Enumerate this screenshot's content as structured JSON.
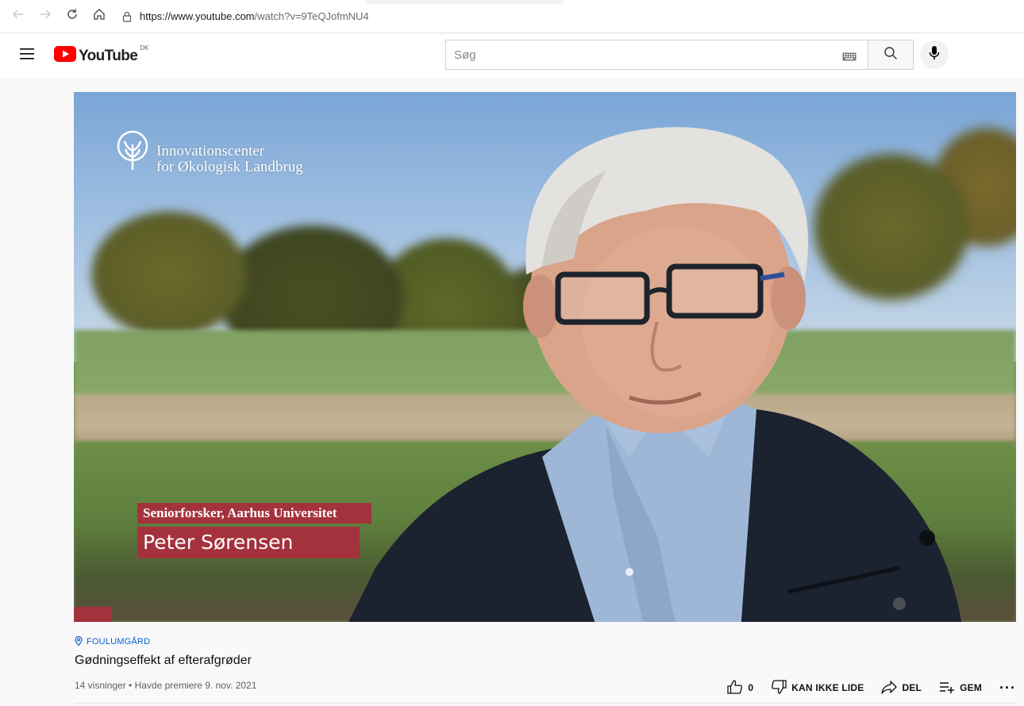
{
  "browser": {
    "url_host": "https://www.youtube.com",
    "url_path": "/watch?v=9TeQJofmNU4"
  },
  "masthead": {
    "logo_text": "YouTube",
    "country_code": "DK",
    "search_placeholder": "Søg",
    "search_value": ""
  },
  "video": {
    "overlay_org_line1": "Innovationscenter",
    "overlay_org_line2": "for Økologisk Landbrug",
    "overlay_role": "Seniorforsker, Aarhus Universitet",
    "overlay_name": "Peter Sørensen"
  },
  "info": {
    "location": "FOULUMGÅRD",
    "title": "Gødningseffekt af efterafgrøder",
    "meta": "14 visninger • Havde premiere 9. nov. 2021"
  },
  "actions": {
    "like_count": "0",
    "dislike_label": "KAN IKKE LIDE",
    "share_label": "DEL",
    "save_label": "GEM",
    "more_label": "···"
  },
  "colors": {
    "accent_red": "#ff0000",
    "lower_third": "#a4323d",
    "link_blue": "#065fd4"
  },
  "icons": [
    "back-arrow-icon",
    "forward-arrow-icon",
    "reload-icon",
    "home-icon",
    "lock-icon",
    "hamburger-menu-icon",
    "youtube-play-icon",
    "keyboard-icon",
    "search-icon",
    "microphone-icon",
    "location-pin-icon",
    "thumbs-up-icon",
    "thumbs-down-icon",
    "share-icon",
    "save-playlist-icon",
    "more-icon"
  ]
}
